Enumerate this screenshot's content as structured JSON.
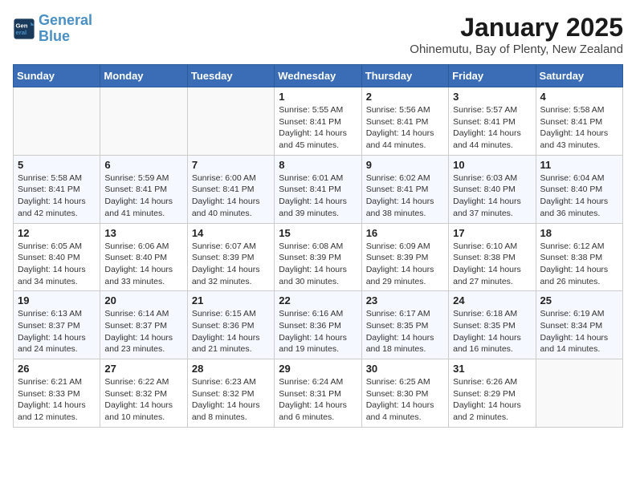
{
  "header": {
    "logo_line1": "General",
    "logo_line2": "Blue",
    "month": "January 2025",
    "location": "Ohinemutu, Bay of Plenty, New Zealand"
  },
  "weekdays": [
    "Sunday",
    "Monday",
    "Tuesday",
    "Wednesday",
    "Thursday",
    "Friday",
    "Saturday"
  ],
  "weeks": [
    [
      {
        "day": "",
        "info": ""
      },
      {
        "day": "",
        "info": ""
      },
      {
        "day": "",
        "info": ""
      },
      {
        "day": "1",
        "info": "Sunrise: 5:55 AM\nSunset: 8:41 PM\nDaylight: 14 hours\nand 45 minutes."
      },
      {
        "day": "2",
        "info": "Sunrise: 5:56 AM\nSunset: 8:41 PM\nDaylight: 14 hours\nand 44 minutes."
      },
      {
        "day": "3",
        "info": "Sunrise: 5:57 AM\nSunset: 8:41 PM\nDaylight: 14 hours\nand 44 minutes."
      },
      {
        "day": "4",
        "info": "Sunrise: 5:58 AM\nSunset: 8:41 PM\nDaylight: 14 hours\nand 43 minutes."
      }
    ],
    [
      {
        "day": "5",
        "info": "Sunrise: 5:58 AM\nSunset: 8:41 PM\nDaylight: 14 hours\nand 42 minutes."
      },
      {
        "day": "6",
        "info": "Sunrise: 5:59 AM\nSunset: 8:41 PM\nDaylight: 14 hours\nand 41 minutes."
      },
      {
        "day": "7",
        "info": "Sunrise: 6:00 AM\nSunset: 8:41 PM\nDaylight: 14 hours\nand 40 minutes."
      },
      {
        "day": "8",
        "info": "Sunrise: 6:01 AM\nSunset: 8:41 PM\nDaylight: 14 hours\nand 39 minutes."
      },
      {
        "day": "9",
        "info": "Sunrise: 6:02 AM\nSunset: 8:41 PM\nDaylight: 14 hours\nand 38 minutes."
      },
      {
        "day": "10",
        "info": "Sunrise: 6:03 AM\nSunset: 8:40 PM\nDaylight: 14 hours\nand 37 minutes."
      },
      {
        "day": "11",
        "info": "Sunrise: 6:04 AM\nSunset: 8:40 PM\nDaylight: 14 hours\nand 36 minutes."
      }
    ],
    [
      {
        "day": "12",
        "info": "Sunrise: 6:05 AM\nSunset: 8:40 PM\nDaylight: 14 hours\nand 34 minutes."
      },
      {
        "day": "13",
        "info": "Sunrise: 6:06 AM\nSunset: 8:40 PM\nDaylight: 14 hours\nand 33 minutes."
      },
      {
        "day": "14",
        "info": "Sunrise: 6:07 AM\nSunset: 8:39 PM\nDaylight: 14 hours\nand 32 minutes."
      },
      {
        "day": "15",
        "info": "Sunrise: 6:08 AM\nSunset: 8:39 PM\nDaylight: 14 hours\nand 30 minutes."
      },
      {
        "day": "16",
        "info": "Sunrise: 6:09 AM\nSunset: 8:39 PM\nDaylight: 14 hours\nand 29 minutes."
      },
      {
        "day": "17",
        "info": "Sunrise: 6:10 AM\nSunset: 8:38 PM\nDaylight: 14 hours\nand 27 minutes."
      },
      {
        "day": "18",
        "info": "Sunrise: 6:12 AM\nSunset: 8:38 PM\nDaylight: 14 hours\nand 26 minutes."
      }
    ],
    [
      {
        "day": "19",
        "info": "Sunrise: 6:13 AM\nSunset: 8:37 PM\nDaylight: 14 hours\nand 24 minutes."
      },
      {
        "day": "20",
        "info": "Sunrise: 6:14 AM\nSunset: 8:37 PM\nDaylight: 14 hours\nand 23 minutes."
      },
      {
        "day": "21",
        "info": "Sunrise: 6:15 AM\nSunset: 8:36 PM\nDaylight: 14 hours\nand 21 minutes."
      },
      {
        "day": "22",
        "info": "Sunrise: 6:16 AM\nSunset: 8:36 PM\nDaylight: 14 hours\nand 19 minutes."
      },
      {
        "day": "23",
        "info": "Sunrise: 6:17 AM\nSunset: 8:35 PM\nDaylight: 14 hours\nand 18 minutes."
      },
      {
        "day": "24",
        "info": "Sunrise: 6:18 AM\nSunset: 8:35 PM\nDaylight: 14 hours\nand 16 minutes."
      },
      {
        "day": "25",
        "info": "Sunrise: 6:19 AM\nSunset: 8:34 PM\nDaylight: 14 hours\nand 14 minutes."
      }
    ],
    [
      {
        "day": "26",
        "info": "Sunrise: 6:21 AM\nSunset: 8:33 PM\nDaylight: 14 hours\nand 12 minutes."
      },
      {
        "day": "27",
        "info": "Sunrise: 6:22 AM\nSunset: 8:32 PM\nDaylight: 14 hours\nand 10 minutes."
      },
      {
        "day": "28",
        "info": "Sunrise: 6:23 AM\nSunset: 8:32 PM\nDaylight: 14 hours\nand 8 minutes."
      },
      {
        "day": "29",
        "info": "Sunrise: 6:24 AM\nSunset: 8:31 PM\nDaylight: 14 hours\nand 6 minutes."
      },
      {
        "day": "30",
        "info": "Sunrise: 6:25 AM\nSunset: 8:30 PM\nDaylight: 14 hours\nand 4 minutes."
      },
      {
        "day": "31",
        "info": "Sunrise: 6:26 AM\nSunset: 8:29 PM\nDaylight: 14 hours\nand 2 minutes."
      },
      {
        "day": "",
        "info": ""
      }
    ]
  ]
}
